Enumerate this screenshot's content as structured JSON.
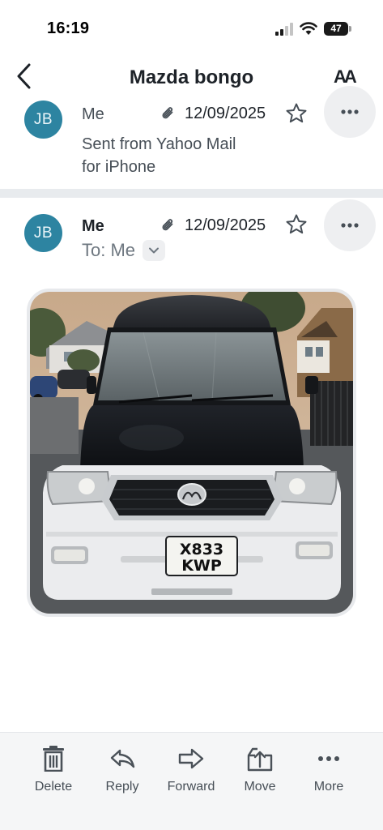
{
  "status_bar": {
    "time": "16:19",
    "battery_level": "47",
    "icons": [
      "signal-icon",
      "wifi-icon",
      "battery-icon"
    ]
  },
  "header": {
    "title": "Mazda bongo",
    "back_icon": "chevron-left-icon",
    "text_size_label": "AA"
  },
  "thread": {
    "messages": [
      {
        "avatar_initials": "JB",
        "sender": "Me",
        "date": "12/09/2025",
        "has_attachment": true,
        "body_lines": [
          "Sent from Yahoo Mail",
          "for iPhone"
        ]
      },
      {
        "avatar_initials": "JB",
        "sender": "Me",
        "date": "12/09/2025",
        "has_attachment": true,
        "to_line": "To: Me",
        "attachment": {
          "type": "photo",
          "plate_line1": "X833",
          "plate_line2": "KWP"
        }
      }
    ]
  },
  "toolbar": {
    "items": [
      {
        "label": "Delete",
        "icon": "trash-icon"
      },
      {
        "label": "Reply",
        "icon": "reply-icon"
      },
      {
        "label": "Forward",
        "icon": "forward-icon"
      },
      {
        "label": "Move",
        "icon": "move-icon"
      },
      {
        "label": "More",
        "icon": "more-dots-icon"
      }
    ]
  },
  "colors": {
    "avatar": "#2d84a1",
    "divider": "#e8ebee",
    "toolbar_bg": "#f5f6f7",
    "icon_dark": "#4a5158"
  }
}
